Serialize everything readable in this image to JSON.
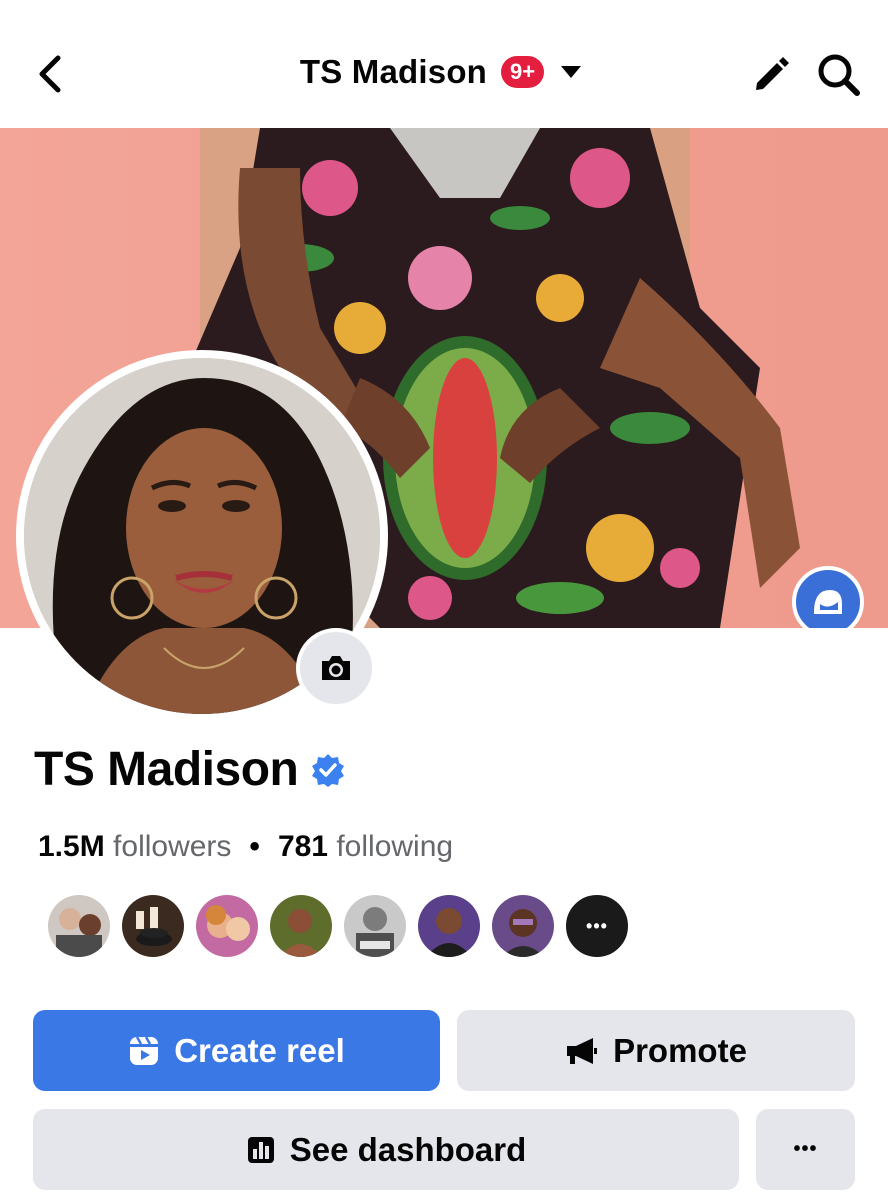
{
  "header": {
    "title": "TS Madison",
    "notification_badge": "9+"
  },
  "profile": {
    "name": "TS Madison",
    "verified": true,
    "followers_count": "1.5M",
    "followers_label": "followers",
    "separator": "•",
    "following_count": "781",
    "following_label": "following",
    "friends_more_label": "•••"
  },
  "actions": {
    "create_reel": "Create reel",
    "promote": "Promote",
    "see_dashboard": "See dashboard",
    "more": "•••"
  },
  "colors": {
    "primary_blue": "#3a78e6",
    "badge_red": "#e41e3f",
    "button_gray": "#e4e6eb",
    "muted_text": "#65676b",
    "verified_blue": "#3b82f0",
    "cover_background": "#f0a396"
  },
  "icons": {
    "back": "back-chevron-icon",
    "dropdown": "caret-down-icon",
    "edit": "pencil-icon",
    "search": "search-icon",
    "avatar": "avatar-icon",
    "camera": "camera-icon",
    "verified": "verified-badge-icon",
    "reel": "reel-icon",
    "megaphone": "megaphone-icon",
    "dashboard": "bar-chart-icon"
  }
}
